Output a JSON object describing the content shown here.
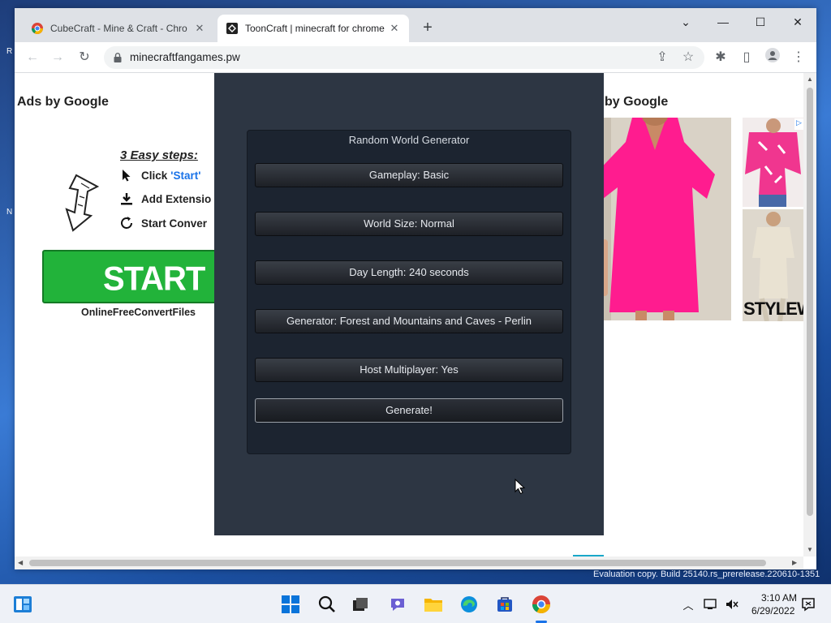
{
  "browser": {
    "tabs": [
      {
        "title": "CubeCraft - Mine & Craft - Chro",
        "active": false
      },
      {
        "title": "ToonCraft | minecraft for chrome",
        "active": true
      }
    ],
    "url": "minecraftfangames.pw"
  },
  "page": {
    "ads_label_left": "Ads by Google",
    "ads_label_right": "by Google",
    "steps_title": "3 Easy steps:",
    "steps": [
      {
        "label": "Click",
        "accent": "'Start'"
      },
      {
        "label": "Add Extensio",
        "accent": ""
      },
      {
        "label": "Start Conver",
        "accent": ""
      }
    ],
    "start_label": "START",
    "start_caption": "OnlineFreeConvertFiles",
    "ad_brand": "STYLEWI"
  },
  "generator": {
    "title": "Random World Generator",
    "options": [
      "Gameplay: Basic",
      "World Size: Normal",
      "Day Length: 240 seconds",
      "Generator: Forest and Mountains and Caves - Perlin",
      "Host Multiplayer: Yes"
    ],
    "generate_label": "Generate!"
  },
  "taskbar": {
    "time": "3:10 AM",
    "date": "6/29/2022"
  },
  "watermark": "Evaluation copy. Build 25140.rs_prerelease.220610-1351",
  "colors": {
    "start_green": "#22b33a",
    "panel_bg": "#2d3643",
    "accent_blue": "#1a73e8"
  }
}
